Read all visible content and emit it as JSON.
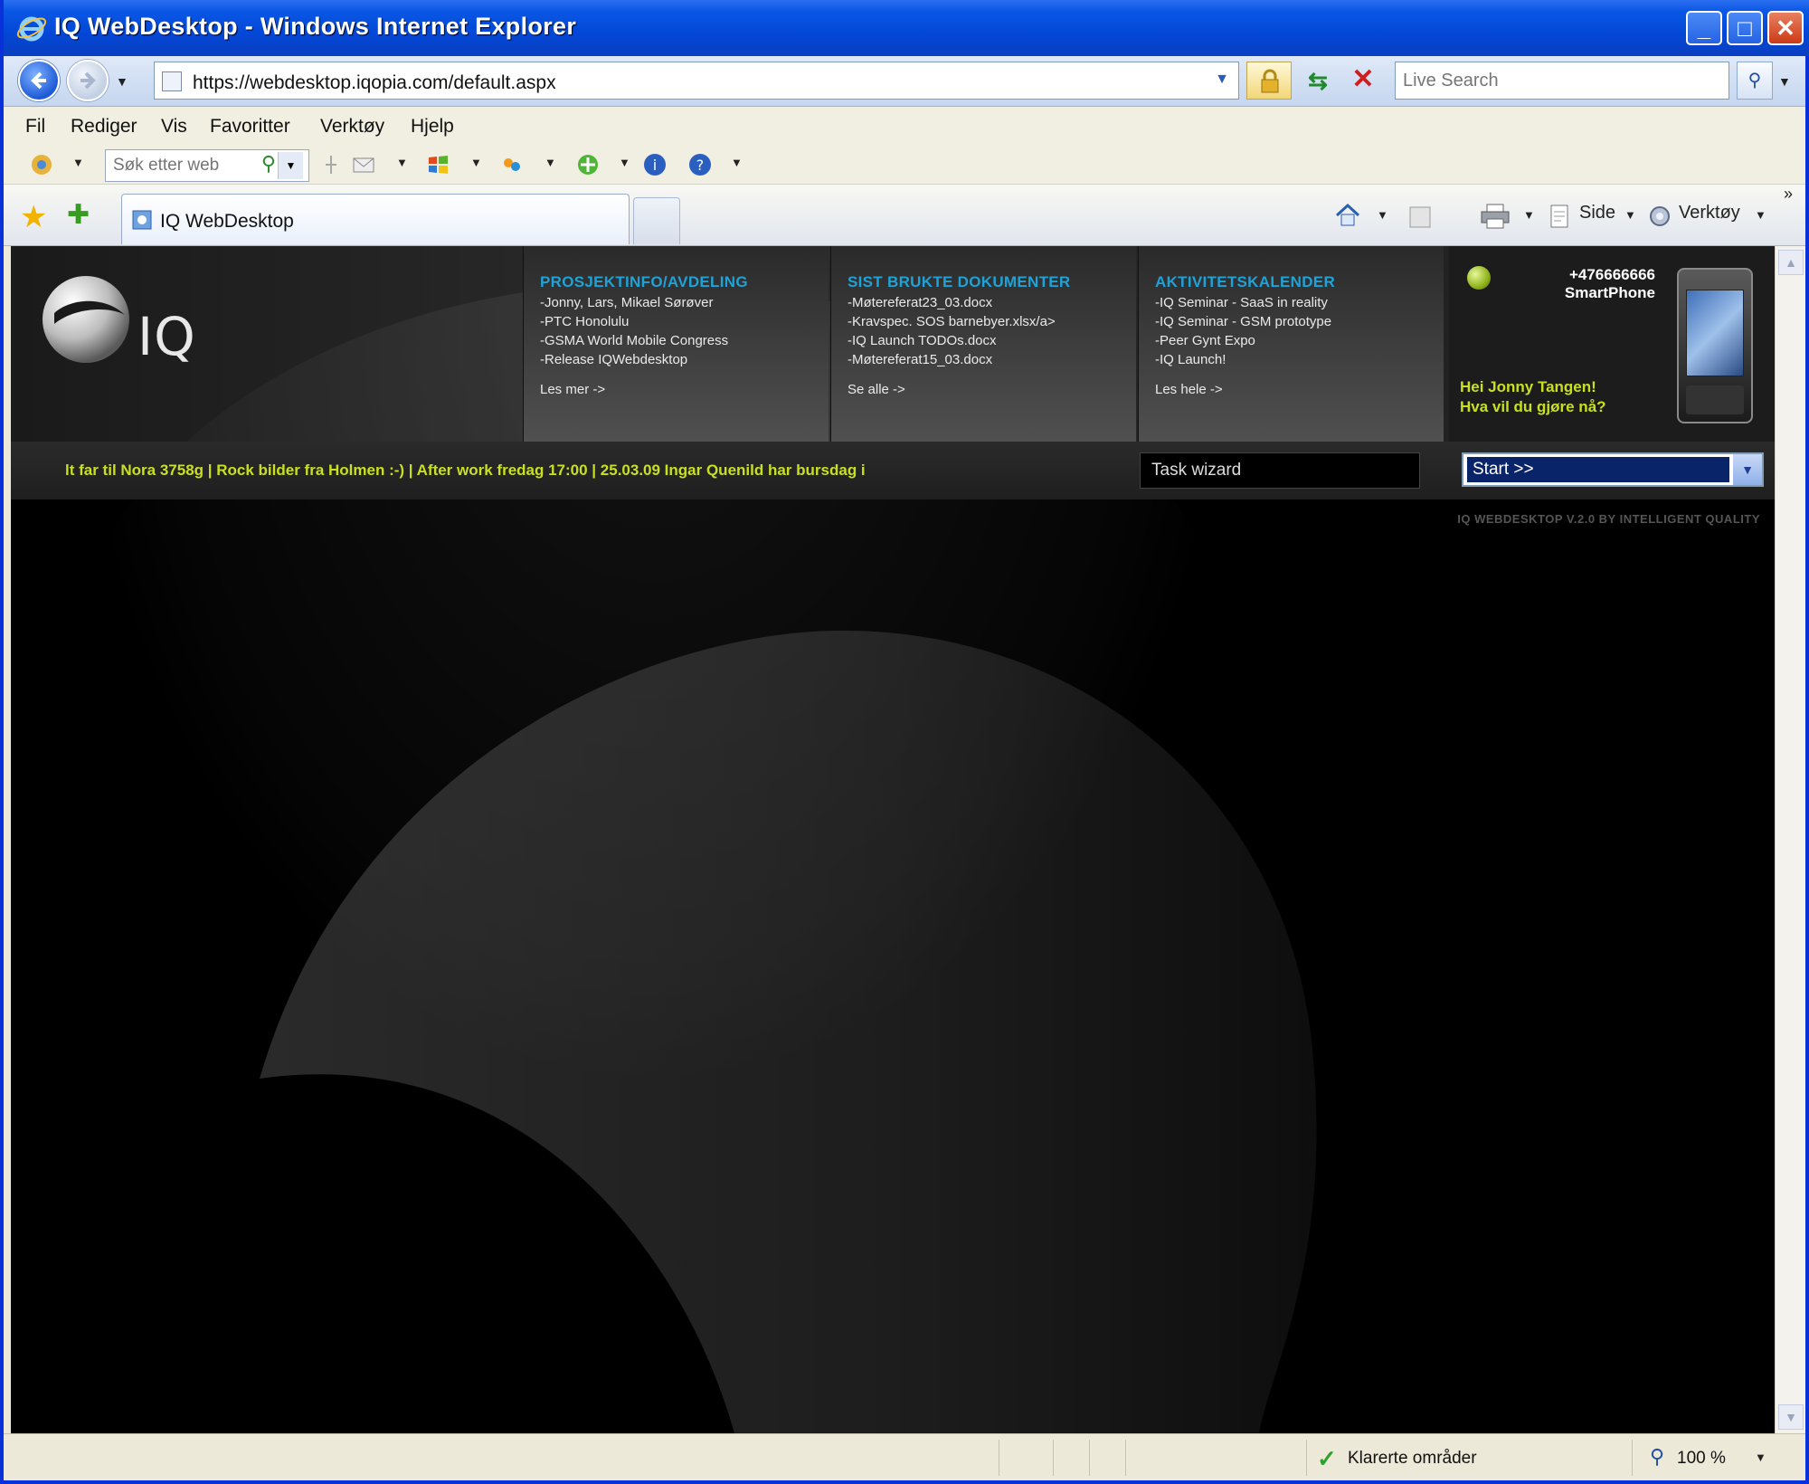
{
  "window": {
    "title": "IQ WebDesktop - Windows Internet Explorer"
  },
  "address": {
    "url": "https://webdesktop.iqopia.com/default.aspx",
    "search_placeholder": "Live Search"
  },
  "menu": {
    "items": [
      "Fil",
      "Rediger",
      "Vis",
      "Favoritter",
      "Verktøy",
      "Hjelp"
    ]
  },
  "toolbar": {
    "search_placeholder": "Søk etter web"
  },
  "tabs": {
    "active_label": "IQ WebDesktop"
  },
  "commandbar": {
    "page_label": "Side",
    "tools_label": "Verktøy"
  },
  "page": {
    "logo_text": "IQ",
    "columns": [
      {
        "heading": "PROSJEKTINFO/AVDELING",
        "lines": [
          "-Jonny, Lars, Mikael Sørøver",
          "-PTC Honolulu",
          "-GSMA World Mobile Congress",
          "-Release IQWebdesktop"
        ],
        "more": "Les mer ->"
      },
      {
        "heading": "SIST BRUKTE DOKUMENTER",
        "lines": [
          "-Møtereferat23_03.docx",
          "-Kravspec. SOS barnebyer.xlsx/a>",
          "-IQ Launch TODOs.docx",
          "-Møtereferat15_03.docx"
        ],
        "more": "Se alle ->"
      },
      {
        "heading": "AKTIVITETSKALENDER",
        "lines": [
          "-IQ Seminar - SaaS in reality",
          "-IQ Seminar - GSM prototype",
          "-Peer Gynt Expo",
          "-IQ Launch!"
        ],
        "more": "Les hele ->"
      }
    ],
    "phone_number": "+476666666",
    "phone_model": "SmartPhone",
    "greeting_line1": "Hei Jonny Tangen!",
    "greeting_line2": "Hva vil du gjøre nå?",
    "ticker": "lt far til Nora 3758g  |  Rock bilder fra Holmen :-)  |  After work fredag 17:00  |  25.03.09 Ingar Quenild har bursdag i",
    "task_wizard": "Task wizard",
    "start_select": "Start >>",
    "version": "IQ WEBDESKTOP V.2.0 BY INTELLIGENT QUALITY"
  },
  "status": {
    "zone": "Klarerte områder",
    "zoom": "100 %"
  },
  "colors": {
    "ticker_green": "#c9e01f",
    "heading_blue": "#1ea3d8",
    "xp_blue": "#0a57e5"
  }
}
